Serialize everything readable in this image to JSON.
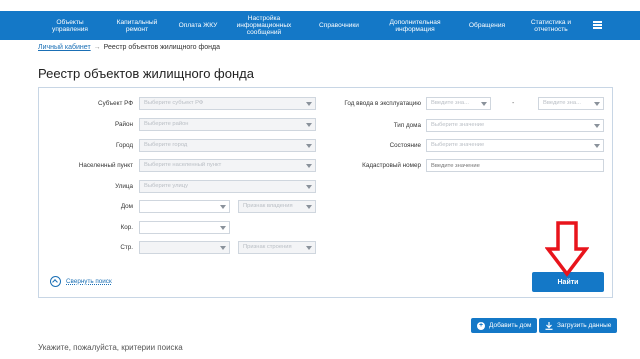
{
  "nav": {
    "items": [
      {
        "label": "Объекты\nуправления"
      },
      {
        "label": "Капитальный\nремонт"
      },
      {
        "label": "Оплата ЖКУ"
      },
      {
        "label": "Настройка\nинформационных\nсообщений"
      },
      {
        "label": "Справочники"
      },
      {
        "label": "Дополнительная\nинформация"
      },
      {
        "label": "Обращения"
      },
      {
        "label": "Статистика и\nотчетность"
      }
    ],
    "menu_icon": "hamburger-icon"
  },
  "breadcrumb": {
    "home": "Личный кабинет",
    "separator": "→",
    "current": "Реестр объектов жилищного фонда"
  },
  "page": {
    "title": "Реестр объектов жилищного фонда"
  },
  "form": {
    "subject": {
      "label": "Субъект РФ",
      "placeholder": "Выберите субъект РФ"
    },
    "district": {
      "label": "Район",
      "placeholder": "Выберите район"
    },
    "city": {
      "label": "Город",
      "placeholder": "Выберите город"
    },
    "settlement": {
      "label": "Населенный пункт",
      "placeholder": "Выберите населенный пункт"
    },
    "street": {
      "label": "Улица",
      "placeholder": "Выберите улицу"
    },
    "house": {
      "label": "Дом",
      "placeholder": "",
      "extra_placeholder": "Признак владения"
    },
    "korpus": {
      "label": "Кор.",
      "placeholder": ""
    },
    "building": {
      "label": "Стр.",
      "placeholder": "",
      "extra_placeholder": "Признак строения"
    },
    "year": {
      "label": "Год ввода в эксплуатацию",
      "from_placeholder": "Введите зна...",
      "dash": "-",
      "to_placeholder": "Введите зна..."
    },
    "house_type": {
      "label": "Тип дома",
      "placeholder": "Выберите значение"
    },
    "state": {
      "label": "Состояние",
      "placeholder": "Выберите значение"
    },
    "cadastral": {
      "label": "Кадастровый номер",
      "placeholder": "Введите значение"
    }
  },
  "actions": {
    "collapse_label": "Свернуть поиск",
    "find_label": "Найти",
    "add_house_label": "Добавить дом",
    "upload_label": "Загрузить данные"
  },
  "hint": "Укажите, пожалуйста, критерии поиска",
  "colors": {
    "nav_bg": "#1478c7",
    "accent": "#1478c7",
    "arrow": "#e8141b"
  }
}
